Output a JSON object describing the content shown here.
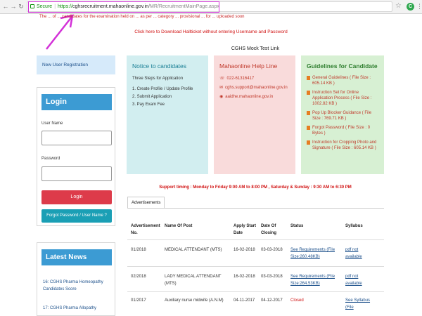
{
  "browser": {
    "secure_label": "Secure",
    "url_scheme": "https://",
    "url_host": "cghsrecruitment.mahaonline.gov.in",
    "url_path": "/MR/RecruitmentMainPage.aspx"
  },
  "top_notice": "The ... of ... candidates for the examination held on ... as per ... category ... provisional ... for ... uploaded soon",
  "hallticket_link": "Click here to Download Hallticket without entering Username and Password",
  "mock_test_link": "CGHS Mock Test Link",
  "new_user_registration": "New User Registration",
  "login": {
    "title": "Login",
    "username_label": "User Name",
    "password_label": "Password",
    "login_button": "Login",
    "forgot_button": "Forgot Password / User Name ?"
  },
  "news": {
    "title": "Latest News",
    "items": [
      "16: CGHS Pharma Homeopathy Candidates Score",
      "17: CGHS Pharma Allopathy"
    ]
  },
  "notice": {
    "title": "Notice to candidates",
    "intro": "Three Steps for Application",
    "steps": [
      "1. Create Profile / Update Profile",
      "2. Submit Application",
      "3. Pay Exam Fee"
    ]
  },
  "helpline": {
    "title": "Mahaonline Help Line",
    "phone": "022-61316417",
    "email": "cghs.support@mahaonline.gov.in",
    "site": "aaidhe.mahaonline.gov.in"
  },
  "guidelines": {
    "title": "Guidelines for Candidate",
    "items": [
      "General Guidelines ( File Size : 605.14 KB )",
      "Instruction Set for Online Application Process ( File Size : 1002.82 KB )",
      "Pop Up Blocker Guidance ( File Size : 769.71 KB )",
      "Forgot Password ( File Size : 0 Bytes )",
      "Instruction for Cropping Photo and Signature ( File Size : 605.14 KB )"
    ]
  },
  "support_timing": "Support timing : Monday to Friday 9:00 AM to 8:00 PM , Saturday & Sunday : 9:30 AM to 6:30 PM",
  "advertisements": {
    "tab_label": "Advertisements",
    "headers": {
      "adv_no": "Advertisement No.",
      "post": "Name Of Post",
      "start": "Apply Start Date",
      "closing": "Date Of Closing",
      "status": "Status",
      "syllabus": "Syllabus"
    },
    "rows": [
      {
        "adv_no": "01/2018",
        "post": "MEDICAL ATTENDANT (MTS)",
        "start": "16-02-2018",
        "closing": "03-03-2018",
        "status": "See Requirements (File Size:260.48KB)",
        "syllabus": "pdf not available"
      },
      {
        "adv_no": "02/2018",
        "post": "LADY MEDICAL ATTENDANT (MTS)",
        "start": "16-02-2018",
        "closing": "03-03-2018",
        "status": "See Requirements (File Size:264.53KB)",
        "syllabus": "pdf not available"
      },
      {
        "adv_no": "01/2017",
        "post": "Auxiliary nurse midwife (A.N.M)",
        "start": "04-11-2017",
        "closing": "04-12-2017",
        "status": "Closed",
        "syllabus": "See Syllabus (File"
      }
    ]
  },
  "colors": {
    "highlight": "#d331d8",
    "login_header": "#3c9bd3",
    "login_button": "#dd3b4a",
    "forgot_button": "#1a9fb5",
    "notice_bg": "#d2eef0",
    "helpline_bg": "#f9dbdb",
    "guidelines_bg": "#d7f0d3",
    "new_user_bg": "#d6eafa"
  }
}
